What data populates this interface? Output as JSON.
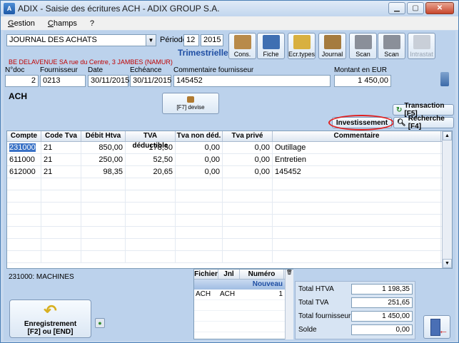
{
  "window": {
    "title": "ADIX - Saisie des écritures  ACH - ADIX GROUP S.A."
  },
  "menu": [
    "Gestion",
    "Champs",
    "?"
  ],
  "header": {
    "journal": "JOURNAL DES ACHATS",
    "periode_label": "Période",
    "periode_num": "12",
    "periode_year": "2015",
    "trimestrielle": "Trimestrielle",
    "supplier_line": "BE DELAVENUE SA rue du Centre, 3 JAMBES (NAMUR)"
  },
  "toolbar": [
    {
      "label": "Cons.",
      "icon": "book-icon",
      "color": "#b88a4a"
    },
    {
      "label": "Fiche",
      "icon": "user-card-icon",
      "color": "#3f6fb2"
    },
    {
      "label": "Ecr.types",
      "icon": "pencil-notes-icon",
      "color": "#d8b040"
    },
    {
      "label": "Journal",
      "icon": "open-book-icon",
      "color": "#a57b3f"
    },
    {
      "label": "Scan",
      "icon": "scanner-icon",
      "color": "#8a8f99"
    },
    {
      "label": "Scan",
      "icon": "scanner-icon",
      "color": "#8a8f99"
    },
    {
      "label": "Intrastat",
      "icon": "intrastat-icon",
      "color": "#c9cfd8"
    }
  ],
  "doc": {
    "labels": {
      "ndoc": "N°doc",
      "fournisseur": "Fournisseur",
      "date": "Date",
      "echeance": "Echéance",
      "commentaire": "Commentaire fournisseur",
      "montant": "Montant en EUR"
    },
    "ndoc": "2",
    "fournisseur": "0213",
    "date": "30/11/2015",
    "echeance": "30/11/2015",
    "commentaire": "145452",
    "montant": "1 450,00"
  },
  "journal_code": "ACH",
  "buttons": {
    "devise": "[F7] devise",
    "transaction": "Transaction [F5]",
    "investissement": "Investissement",
    "recherche": "Recherche [F4]",
    "enregistrement_1": "Enregistrement",
    "enregistrement_2": "[F2] ou [END]"
  },
  "grid": {
    "columns": [
      "Compte",
      "Code Tva",
      "Débit Htva",
      "TVA déductible",
      "Tva non déd.",
      "Tva privé",
      "Commentaire"
    ],
    "rows": [
      [
        "231000",
        "21",
        "850,00",
        "178,50",
        "0,00",
        "0,00",
        "Outillage"
      ],
      [
        "611000",
        "21",
        "250,00",
        "52,50",
        "0,00",
        "0,00",
        "Entretien"
      ],
      [
        "612000",
        "21",
        "98,35",
        "20,65",
        "0,00",
        "0,00",
        "145452"
      ]
    ]
  },
  "account_caption": "231000: MACHINES",
  "mini_grid": {
    "columns": [
      "Fichier",
      "Jnl",
      "Numéro"
    ],
    "nouveau": "Nouveau",
    "rows": [
      [
        "ACH",
        "ACH",
        "1"
      ]
    ]
  },
  "totals": [
    {
      "label": "Total HTVA",
      "value": "1 198,35"
    },
    {
      "label": "Total TVA",
      "value": "251,65"
    },
    {
      "label": "Total fournisseur",
      "value": "1 450,00"
    },
    {
      "label": "Solde",
      "value": "0,00"
    }
  ]
}
